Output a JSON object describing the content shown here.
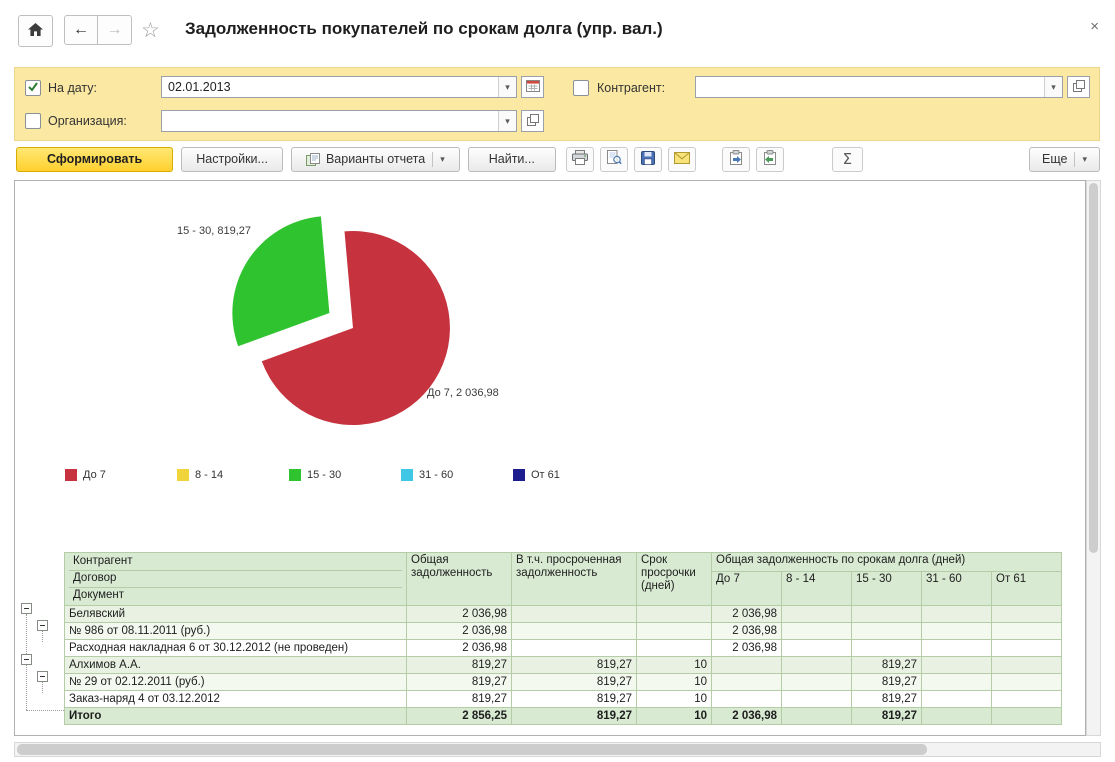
{
  "window": {
    "title": "Задолженность покупателей по срокам долга (упр. вал.)",
    "close_glyph": "×",
    "back_glyph": "←",
    "forward_glyph": "→",
    "star_glyph": "☆"
  },
  "filters": {
    "date": {
      "label": "На дату:",
      "value": "02.01.2013",
      "checked": true
    },
    "counterparty": {
      "label": "Контрагент:",
      "value": "",
      "checked": false
    },
    "organization": {
      "label": "Организация:",
      "value": "",
      "checked": false
    },
    "dropdown_glyph": "▾"
  },
  "toolbar": {
    "generate": "Сформировать",
    "settings": "Настройки...",
    "report_variants": "Варианты отчета",
    "find": "Найти...",
    "more": "Еще",
    "sum_glyph": "Σ",
    "dropdown_glyph": "▾"
  },
  "chart_data": {
    "type": "pie",
    "categories": [
      "До 7",
      "8 - 14",
      "15 - 30",
      "31 - 60",
      "От 61"
    ],
    "values": [
      2036.98,
      0,
      819.27,
      0,
      0
    ],
    "colors": [
      "#c6323e",
      "#efd43c",
      "#2fc42f",
      "#41c7e6",
      "#1d1d8f"
    ],
    "callouts": [
      "15 - 30, 819,27",
      "До 7, 2 036,98"
    ],
    "exploded_slice": "15 - 30",
    "legend_position": "bottom",
    "total": 2856.25
  },
  "legend": [
    {
      "label": "До 7",
      "color": "#c6323e"
    },
    {
      "label": "8 - 14",
      "color": "#efd43c"
    },
    {
      "label": "15 - 30",
      "color": "#2fc42f"
    },
    {
      "label": "31 - 60",
      "color": "#41c7e6"
    },
    {
      "label": "От 61",
      "color": "#1d1d8f"
    }
  ],
  "table": {
    "header": {
      "entity_rows": [
        "Контрагент",
        "Договор",
        "Документ"
      ],
      "total": "Общая задолженность",
      "overdue": "В т.ч. просроченная задолженность",
      "overdue_days": "Срок просрочки (дней)",
      "buckets_group": "Общая задолженность по срокам долга (дней)",
      "buckets": [
        "До 7",
        "8 - 14",
        "15 - 30",
        "31 - 60",
        "От 61"
      ]
    },
    "rows": [
      {
        "type": "group1",
        "indent": 0,
        "name": "Белявский",
        "total": "2 036,98",
        "overdue": "",
        "days": "",
        "buckets": [
          "2 036,98",
          "",
          "",
          "",
          ""
        ]
      },
      {
        "type": "group2",
        "indent": 1,
        "name": "№ 986 от 08.11.2011 (руб.)",
        "total": "2 036,98",
        "overdue": "",
        "days": "",
        "buckets": [
          "2 036,98",
          "",
          "",
          "",
          ""
        ]
      },
      {
        "type": "detail",
        "indent": 2,
        "name": "Расходная накладная 6 от 30.12.2012 (не проведен)",
        "total": "2 036,98",
        "overdue": "",
        "days": "",
        "buckets": [
          "2 036,98",
          "",
          "",
          "",
          ""
        ]
      },
      {
        "type": "group1",
        "indent": 0,
        "name": "Алхимов А.А.",
        "total": "819,27",
        "overdue": "819,27",
        "days": "10",
        "buckets": [
          "",
          "",
          "819,27",
          "",
          ""
        ]
      },
      {
        "type": "group2",
        "indent": 1,
        "name": "№ 29 от 02.12.2011 (руб.)",
        "total": "819,27",
        "overdue": "819,27",
        "days": "10",
        "buckets": [
          "",
          "",
          "819,27",
          "",
          ""
        ]
      },
      {
        "type": "detail",
        "indent": 2,
        "name": "Заказ-наряд 4 от 03.12.2012",
        "total": "819,27",
        "overdue": "819,27",
        "days": "10",
        "buckets": [
          "",
          "",
          "819,27",
          "",
          ""
        ]
      },
      {
        "type": "total",
        "indent": 0,
        "name": "Итого",
        "total": "2 856,25",
        "overdue": "819,27",
        "days": "10",
        "buckets": [
          "2 036,98",
          "",
          "819,27",
          "",
          ""
        ]
      }
    ]
  }
}
